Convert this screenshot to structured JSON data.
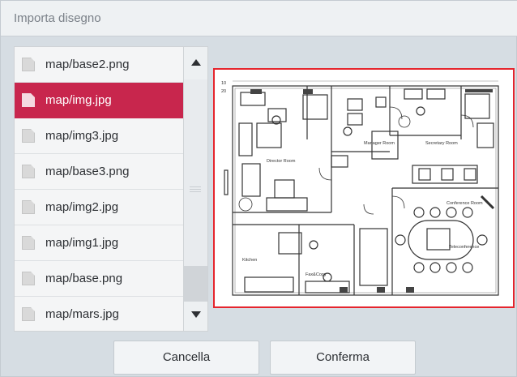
{
  "dialog": {
    "title": "Importa disegno"
  },
  "files": [
    {
      "name": "map/base2.png",
      "selected": false
    },
    {
      "name": "map/img.jpg",
      "selected": true
    },
    {
      "name": "map/img3.jpg",
      "selected": false
    },
    {
      "name": "map/base3.png",
      "selected": false
    },
    {
      "name": "map/img2.jpg",
      "selected": false
    },
    {
      "name": "map/img1.jpg",
      "selected": false
    },
    {
      "name": "map/base.png",
      "selected": false
    },
    {
      "name": "map/mars.jpg",
      "selected": false
    }
  ],
  "preview": {
    "floorplan_labels": {
      "dim_top": "10",
      "dim_left": "20",
      "director_room": "Director Room",
      "manager_room": "Manager Room",
      "secretary_room": "Secretary Room",
      "conference_room": "Conference Room",
      "teleconference": "Teleconference",
      "kitchen": "Kitchen",
      "fax_copy": "Fax&Copy"
    }
  },
  "buttons": {
    "cancel": "Cancella",
    "confirm": "Conferma"
  },
  "colors": {
    "selection": "#c8264d",
    "preview_border": "#e5252d"
  },
  "icons": {
    "file": "file-icon",
    "scroll_up": "triangle-up-icon",
    "scroll_down": "triangle-down-icon"
  }
}
